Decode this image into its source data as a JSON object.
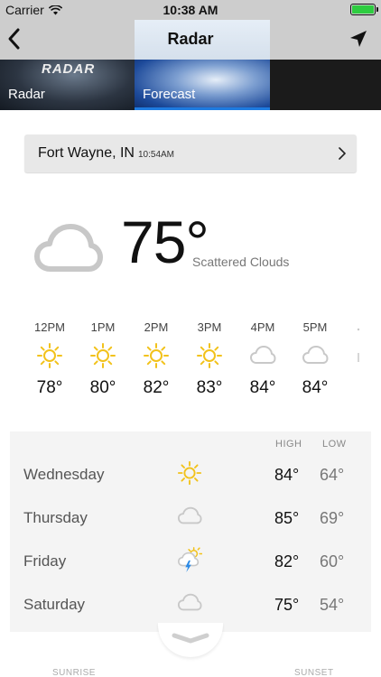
{
  "status_bar": {
    "carrier": "Carrier",
    "time": "10:38 AM"
  },
  "nav": {
    "title": "Radar"
  },
  "tiles": [
    {
      "label": "Radar",
      "logo": "RADAR"
    },
    {
      "label": "Forecast"
    }
  ],
  "location": {
    "name": "Fort Wayne, IN",
    "time": "10:54AM"
  },
  "current": {
    "temp": "75°",
    "desc": "Scattered Clouds",
    "icon": "cloud-icon"
  },
  "hourly": [
    {
      "time": "12PM",
      "icon": "sun-icon",
      "temp": "78°"
    },
    {
      "time": "1PM",
      "icon": "sun-icon",
      "temp": "80°"
    },
    {
      "time": "2PM",
      "icon": "sun-icon",
      "temp": "82°"
    },
    {
      "time": "3PM",
      "icon": "sun-icon",
      "temp": "83°"
    },
    {
      "time": "4PM",
      "icon": "cloud-icon",
      "temp": "84°"
    },
    {
      "time": "5PM",
      "icon": "cloud-icon",
      "temp": "84°"
    }
  ],
  "daily": {
    "high_label": "HIGH",
    "low_label": "LOW",
    "days": [
      {
        "name": "Wednesday",
        "icon": "sun-icon",
        "high": "84°",
        "low": "64°"
      },
      {
        "name": "Thursday",
        "icon": "cloud-icon",
        "high": "85°",
        "low": "69°"
      },
      {
        "name": "Friday",
        "icon": "thunderstorm-sun-icon",
        "high": "82°",
        "low": "60°"
      },
      {
        "name": "Saturday",
        "icon": "cloud-icon",
        "high": "75°",
        "low": "54°"
      }
    ]
  },
  "sun": {
    "sunrise_label": "SUNRISE",
    "sunset_label": "SUNSET"
  },
  "colors": {
    "sun": "#f2c21b",
    "cloud": "#c8c8c8",
    "accent": "#1e7be0",
    "battery": "#2ecc40"
  }
}
